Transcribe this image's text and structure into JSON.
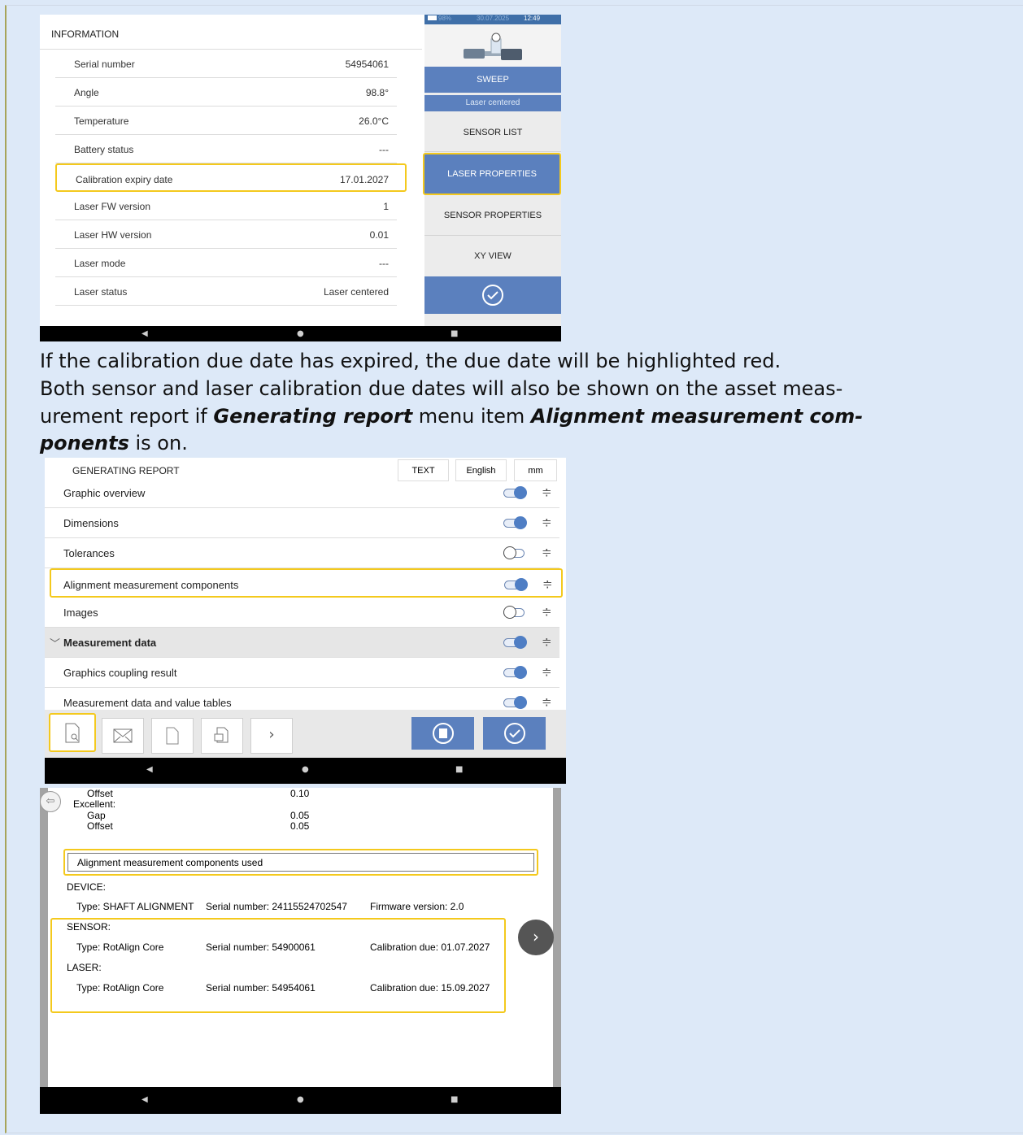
{
  "screen1": {
    "title": "INFORMATION",
    "rows": [
      {
        "label": "Serial number",
        "value": "54954061"
      },
      {
        "label": "Angle",
        "value": "98.8°"
      },
      {
        "label": "Temperature",
        "value": "26.0°C"
      },
      {
        "label": "Battery status",
        "value": "---"
      },
      {
        "label": "Calibration expiry date",
        "value": "17.01.2027"
      },
      {
        "label": "Laser FW version",
        "value": "1"
      },
      {
        "label": "Laser HW version",
        "value": "0.01"
      },
      {
        "label": "Laser mode",
        "value": "---"
      },
      {
        "label": "Laser status",
        "value": "Laser centered"
      }
    ],
    "status_battery": "98%",
    "status_datetime": "30.07.2025",
    "status_time": "12:49",
    "menu": {
      "sweep": "SWEEP",
      "laser_centered": "Laser centered",
      "sensor_list": "SENSOR LIST",
      "laser_properties": "LASER PROPERTIES",
      "sensor_properties": "SENSOR PROPERTIES",
      "xy_view": "XY VIEW"
    }
  },
  "text": {
    "line1": "If the calibration due date has expired, the due date will be highlighted red.",
    "line2": "Both sensor and laser calibration due dates will also be shown on the asset meas-",
    "line3a": "urement report if ",
    "line3b": "Generating report",
    "line3c": " menu item ",
    "line3d": "Alignment measurement com-",
    "line4a": "ponents",
    "line4b": " is on."
  },
  "screen2": {
    "title": "GENERATING REPORT",
    "btn_text": "TEXT",
    "btn_lang": "English",
    "btn_unit": "mm",
    "rows": [
      {
        "label": "Graphic overview",
        "on": true
      },
      {
        "label": "Dimensions",
        "on": true
      },
      {
        "label": "Tolerances",
        "on": false
      },
      {
        "label": "Alignment measurement components",
        "on": true
      },
      {
        "label": "Images",
        "on": false
      },
      {
        "label": "Measurement data",
        "on": true
      },
      {
        "label": "Graphics coupling result",
        "on": true
      },
      {
        "label": "Measurement data and value tables",
        "on": true
      }
    ]
  },
  "screen3": {
    "offset_label": "Offset",
    "offset_value": "0.10",
    "excellent_label": "Excellent:",
    "gap_label": "Gap",
    "gap_value": "0.05",
    "offset2_label": "Offset",
    "offset2_value": "0.05",
    "section_title": "Alignment measurement components used",
    "device_label": "DEVICE:",
    "device_type": "Type: SHAFT ALIGNMENT",
    "device_serial": "Serial number: 24115524702547",
    "device_fw": "Firmware version: 2.0",
    "sensor_label": "SENSOR:",
    "sensor_type": "Type: RotAlign Core",
    "sensor_serial": "Serial number: 54900061",
    "sensor_cal": "Calibration due: 01.07.2027",
    "laser_label": "LASER:",
    "laser_type": "Type: RotAlign Core",
    "laser_serial": "Serial number:  54954061",
    "laser_cal": "Calibration due: 15.09.2027"
  },
  "icons": {
    "back": "◀",
    "home": "●",
    "recent": "■",
    "check": "✓",
    "next": "›"
  },
  "colors": {
    "accent": "#5b80be",
    "highlight": "#f4c91d",
    "nav": "#000000"
  }
}
